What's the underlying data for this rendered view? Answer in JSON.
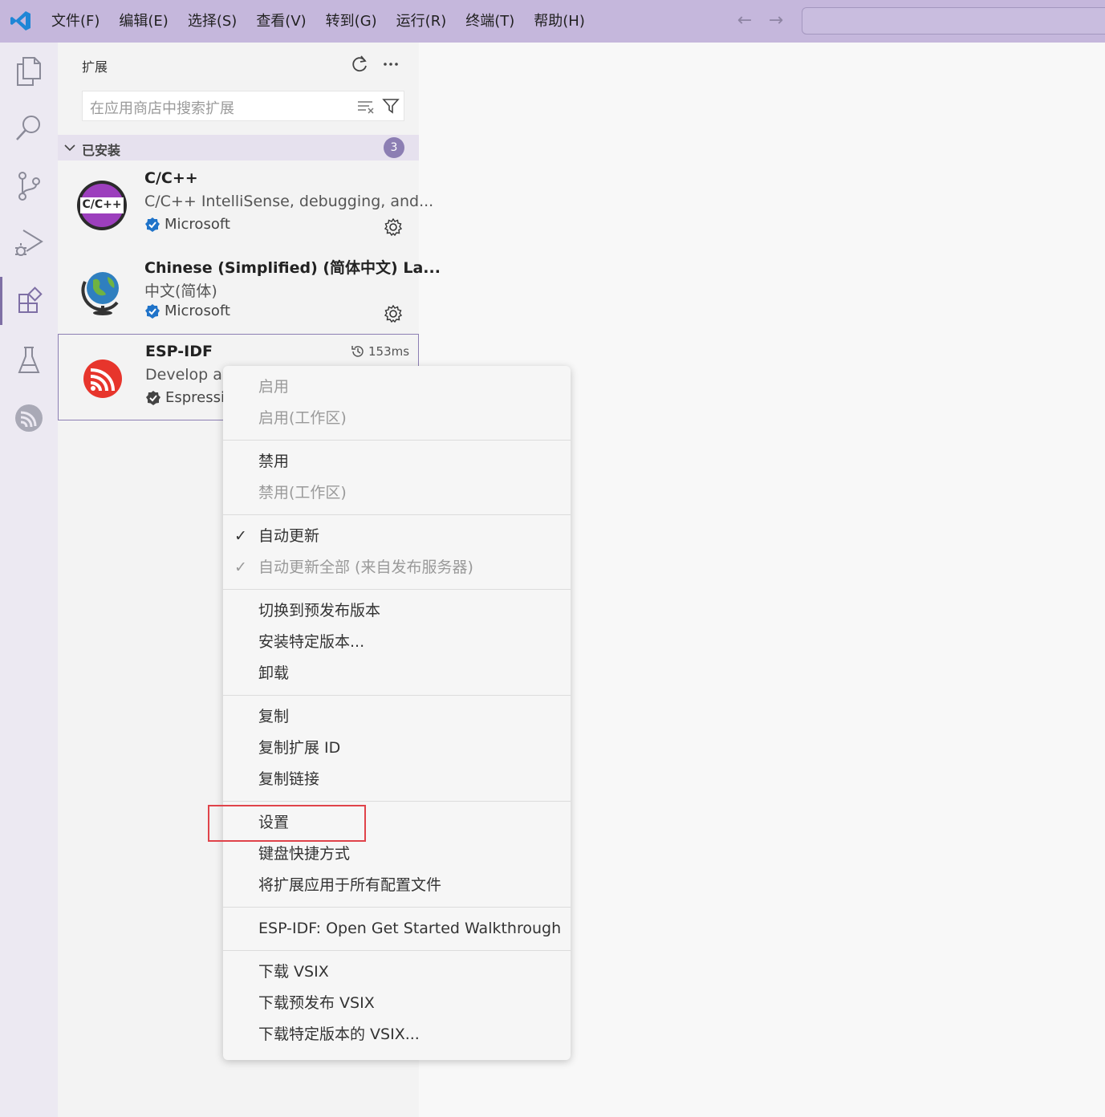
{
  "titlebar": {
    "menu": [
      "文件(F)",
      "编辑(E)",
      "选择(S)",
      "查看(V)",
      "转到(G)",
      "运行(R)",
      "终端(T)",
      "帮助(H)"
    ],
    "back_icon": "arrow-left-icon",
    "forward_icon": "arrow-right-icon"
  },
  "activity_bar": [
    "explorer-icon",
    "search-icon",
    "source-control-icon",
    "run-debug-icon",
    "extensions-icon",
    "testing-icon",
    "espressif-icon"
  ],
  "sidebar": {
    "title": "扩展",
    "search_placeholder": "在应用商店中搜索扩展",
    "section_label": "已安装",
    "installed_count": "3",
    "extensions": [
      {
        "name": "C/C++",
        "icon_text": "C/C++",
        "description": "C/C++ IntelliSense, debugging, and...",
        "publisher": "Microsoft"
      },
      {
        "name": "Chinese (Simplified) (简体中文) La...",
        "description": "中文(简体)",
        "publisher": "Microsoft"
      },
      {
        "name": "ESP-IDF",
        "description": "Develop an",
        "publisher": "Espressif",
        "timing": "153ms"
      }
    ]
  },
  "context_menu": {
    "groups": [
      [
        {
          "label": "启用",
          "disabled": true
        },
        {
          "label": "启用(工作区)",
          "disabled": true
        }
      ],
      [
        {
          "label": "禁用"
        },
        {
          "label": "禁用(工作区)",
          "disabled": true
        }
      ],
      [
        {
          "label": "自动更新",
          "checked": true
        },
        {
          "label": "自动更新全部 (来自发布服务器)",
          "checked": true,
          "disabled": true
        }
      ],
      [
        {
          "label": "切换到预发布版本"
        },
        {
          "label": "安装特定版本..."
        },
        {
          "label": "卸载"
        }
      ],
      [
        {
          "label": "复制"
        },
        {
          "label": "复制扩展 ID"
        },
        {
          "label": "复制链接"
        }
      ],
      [
        {
          "label": "设置",
          "highlighted": true
        },
        {
          "label": "键盘快捷方式"
        },
        {
          "label": "将扩展应用于所有配置文件"
        }
      ],
      [
        {
          "label": "ESP-IDF: Open Get Started Walkthrough"
        }
      ],
      [
        {
          "label": "下载 VSIX"
        },
        {
          "label": "下载预发布 VSIX"
        },
        {
          "label": "下载特定版本的 VSIX..."
        }
      ]
    ],
    "check_glyph": "✓"
  },
  "colors": {
    "titlebar": "#c5b7dc",
    "accent": "#8c7eb3",
    "highlight_border": "#e0434a"
  }
}
